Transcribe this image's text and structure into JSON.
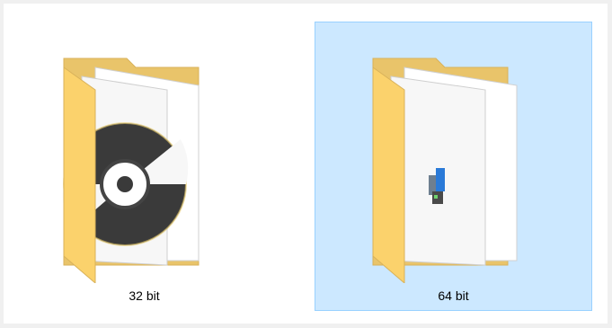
{
  "explorer": {
    "items": [
      {
        "label": "32 bit",
        "selected": false,
        "overlay_icon": "disc-icon"
      },
      {
        "label": "64 bit",
        "selected": true,
        "overlay_icon": "installer-icon"
      }
    ]
  },
  "colors": {
    "selection_fill": "#cce8ff",
    "selection_border": "#99d1ff",
    "folder_back": "#e9c46a",
    "folder_front": "#fbd26c"
  }
}
